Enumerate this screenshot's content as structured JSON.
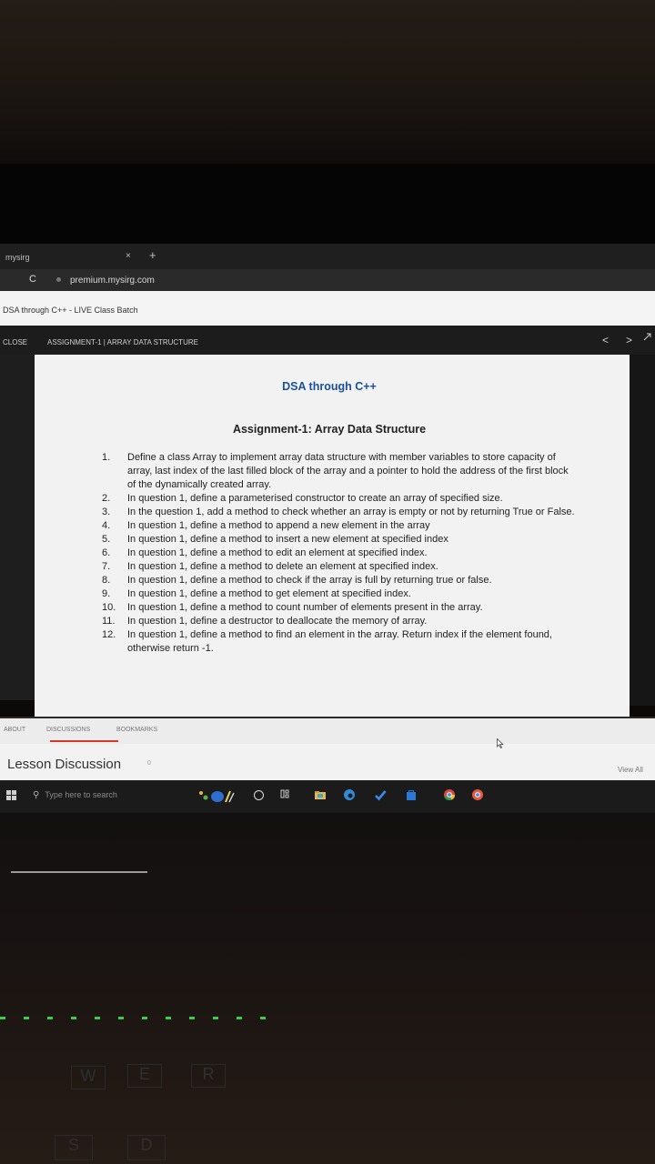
{
  "browser": {
    "tab_title": "mysirg",
    "tab_close": "×",
    "new_tab": "+",
    "reload": "C",
    "url": "premium.mysirg.com"
  },
  "course": {
    "title": "DSA through C++ - LIVE Class Batch"
  },
  "toolbar": {
    "close_label": "CLOSE",
    "assignment_title": "ASSIGNMENT-1 | ARRAY DATA STRUCTURE",
    "prev": "<",
    "next": ">"
  },
  "document": {
    "title": "DSA through C++",
    "subtitle": "Assignment-1: Array Data Structure",
    "questions": [
      {
        "num": "1.",
        "text": "Define a class Array to implement array data structure with member variables to store capacity of array, last index of the last filled block of the array and a pointer to hold the address of the first block of the dynamically created array."
      },
      {
        "num": "2.",
        "text": "In question 1, define a parameterised constructor to create an array of specified size."
      },
      {
        "num": "3.",
        "text": "In the question 1, add a method to check whether an array is empty or not by returning True or False."
      },
      {
        "num": "4.",
        "text": "In question 1, define a method to append a new element in the array"
      },
      {
        "num": "5.",
        "text": "In question 1, define a method to insert a new element at specified index"
      },
      {
        "num": "6.",
        "text": "In question 1, define a method to edit an element at specified index."
      },
      {
        "num": "7.",
        "text": "In question 1, define a method to delete an element at specified index."
      },
      {
        "num": "8.",
        "text": "In question 1, define a method to check if the array is full by returning true or false."
      },
      {
        "num": "9.",
        "text": "In question 1, define a method to get element at specified index."
      },
      {
        "num": "10.",
        "text": "In question 1, define a method to count number of elements present in the array."
      },
      {
        "num": "11.",
        "text": "In question 1, define a destructor to deallocate the memory of array."
      },
      {
        "num": "12.",
        "text": "In question 1, define a method to find an element in the array. Return index if the element found, otherwise return -1."
      }
    ]
  },
  "bottom_tabs": {
    "about": "ABOUT",
    "discussions": "DISCUSSIONS",
    "bookmarks": "BOOKMARKS"
  },
  "discussion": {
    "heading": "Lesson Discussion",
    "count": "0",
    "view_all": "View All"
  },
  "taskbar": {
    "search_placeholder": "Type here to search",
    "icons": [
      "windows-icon",
      "search-icon",
      "weather-icon",
      "cortana-icon",
      "task-view-icon",
      "file-explorer-icon",
      "edge-icon",
      "todo-icon",
      "store-icon",
      "chrome-icon",
      "chrome-profile-icon"
    ]
  },
  "keyboard": {
    "keys": [
      "W",
      "E",
      "R",
      "S",
      "D"
    ]
  },
  "colors": {
    "doc_title": "#1a4f9c",
    "active_tab": "#d2392b",
    "led": "#38d04a"
  }
}
